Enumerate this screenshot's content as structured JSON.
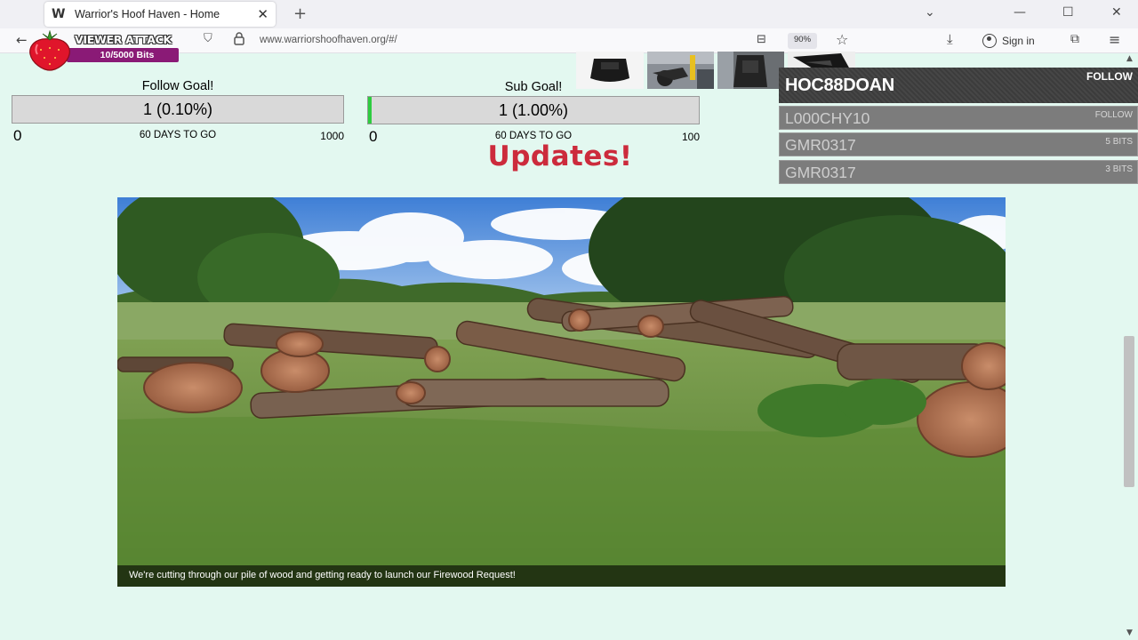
{
  "browser": {
    "tab_title": "Warrior's Hoof Haven - Home",
    "url": "www.warriorshoofhaven.org/#/",
    "zoom": "90%",
    "sign_in_label": "Sign in"
  },
  "viewer_attack": {
    "title": "VIEWER ATTACK",
    "progress_text": "10/5000 Bits",
    "brand_color": "#8a1a76"
  },
  "goals": [
    {
      "title": "Follow Goal!",
      "value": "1 (0.10%)",
      "progress": 0.001,
      "min": "0",
      "days_left": "60 DAYS TO GO",
      "max": "1000"
    },
    {
      "title": "Sub Goal!",
      "value": "1 (1.00%)",
      "progress": 0.01,
      "min": "0",
      "days_left": "60 DAYS TO GO",
      "max": "100"
    }
  ],
  "updates_heading": "Updates!",
  "alerts": {
    "featured": {
      "name": "HOC88DOAN",
      "type": "FOLLOW"
    },
    "recent": [
      {
        "name": "L000CHY10",
        "type": "FOLLOW"
      },
      {
        "name": "GMR0317",
        "type": "5 BITS"
      },
      {
        "name": "GMR0317",
        "type": "3 BITS"
      }
    ]
  },
  "photo": {
    "caption": "We're cutting through our pile of wood and getting ready to launch our Firewood Request!"
  },
  "colors": {
    "page_background": "#e3f8f0",
    "updates_red": "#cc2b3c",
    "goal_fill": "#2ecc40"
  }
}
